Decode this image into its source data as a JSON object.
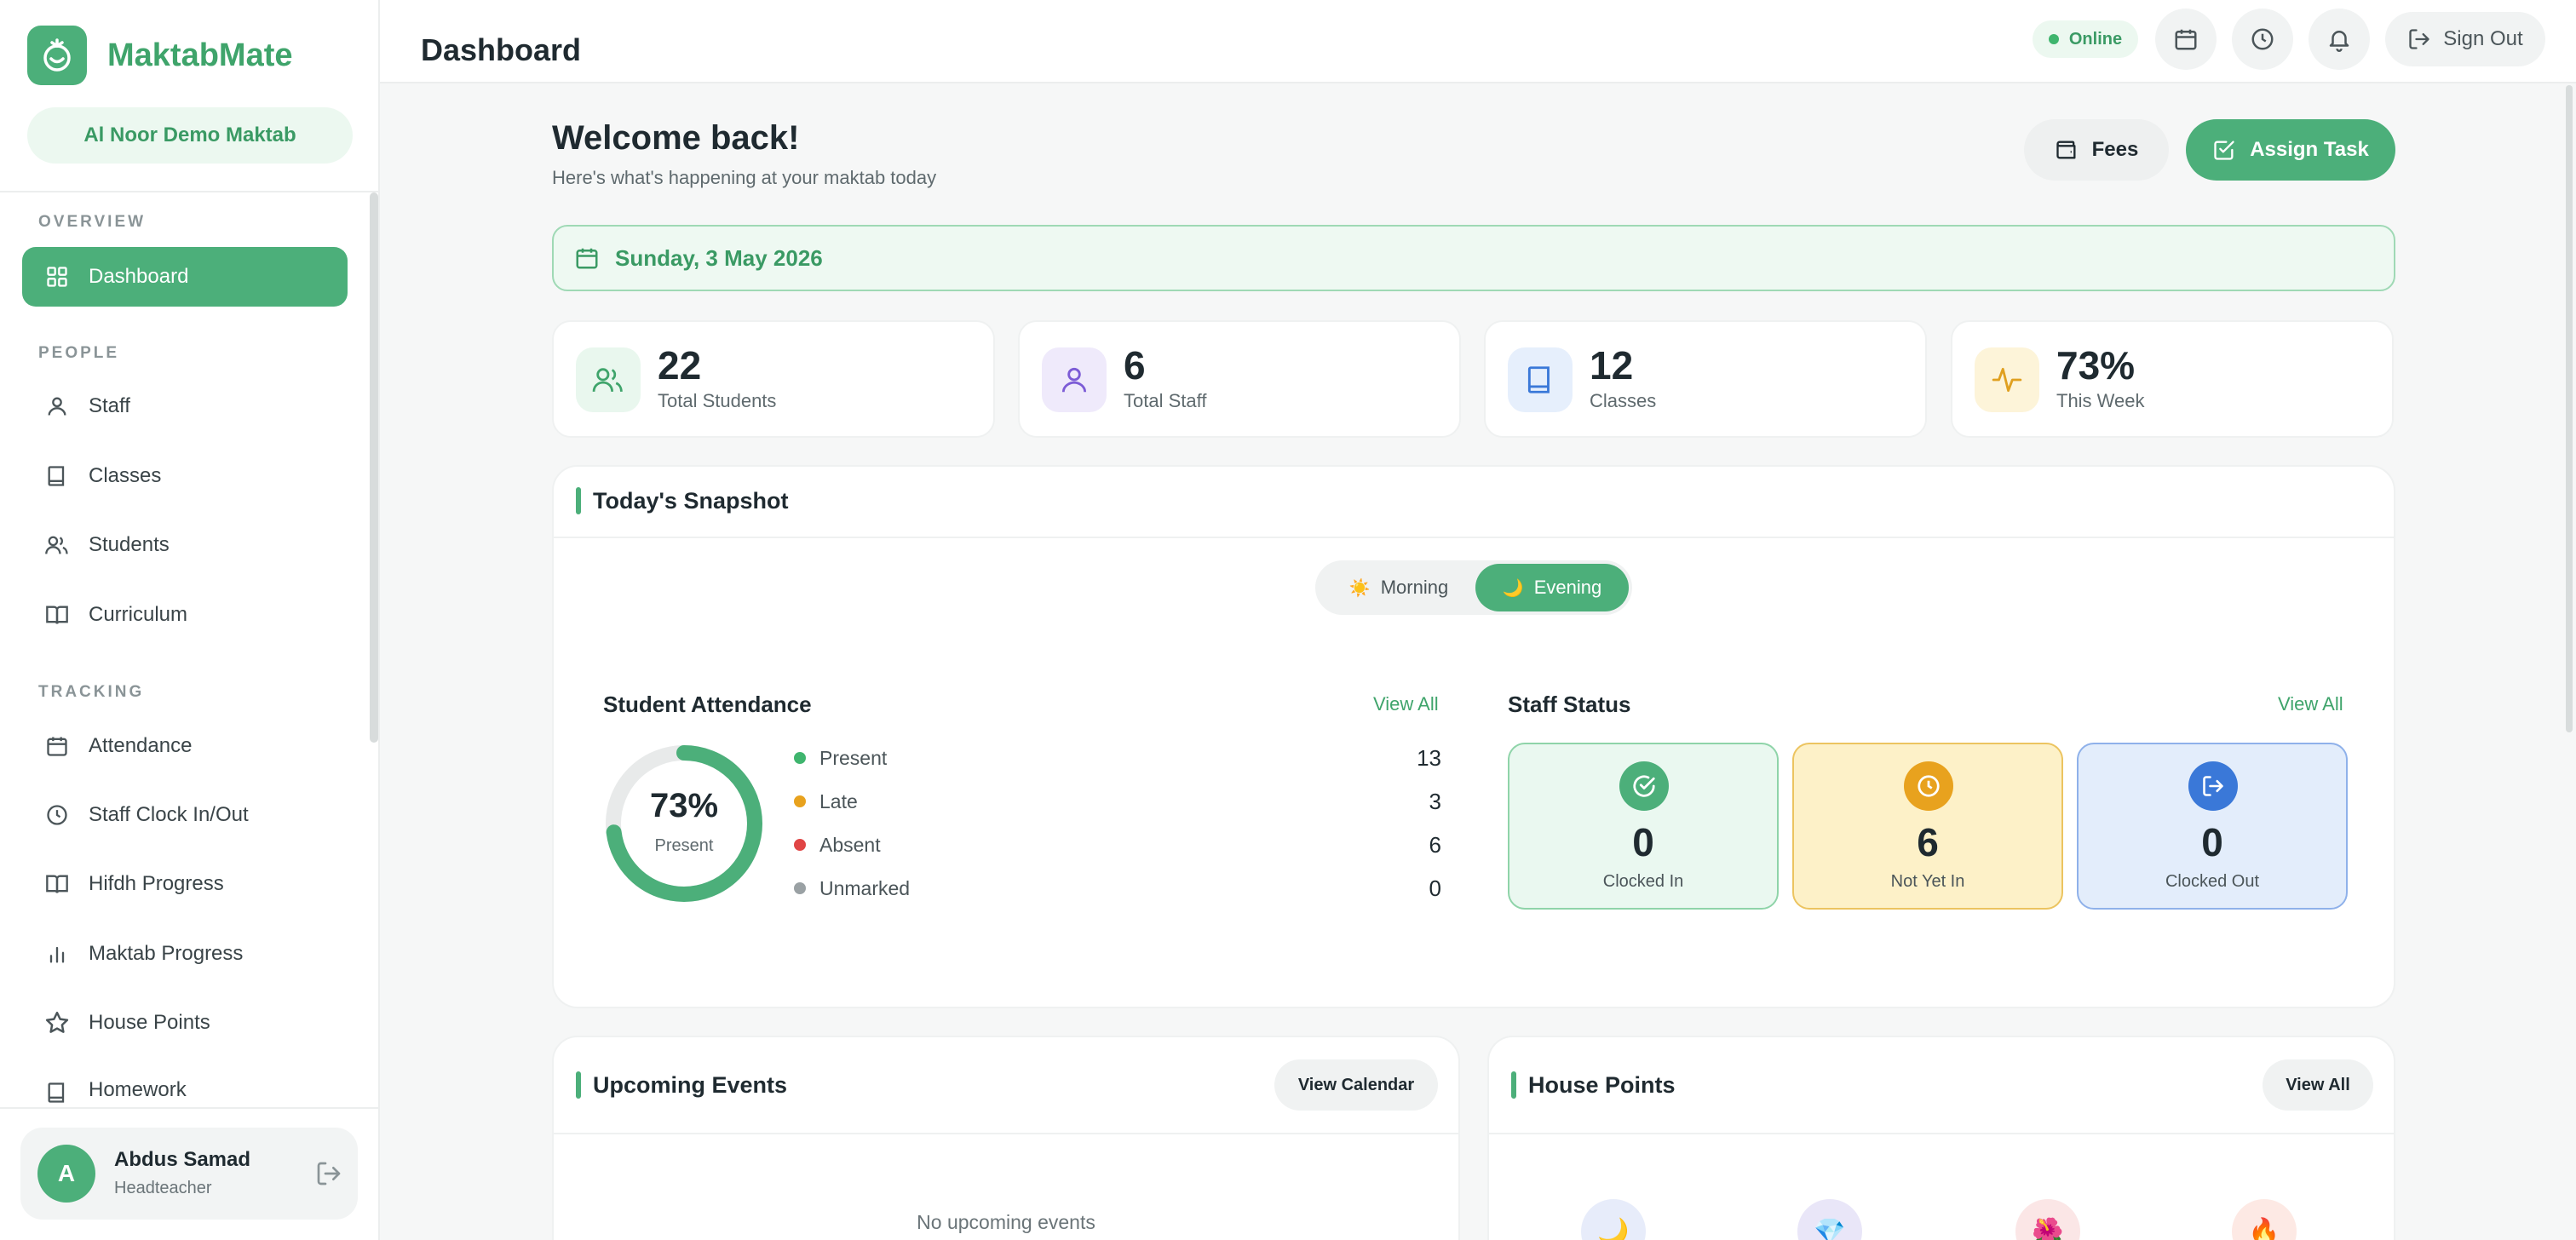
{
  "brand": {
    "name": "MaktabMate",
    "org": "Al Noor Demo Maktab"
  },
  "sidebar": {
    "sections": {
      "overview": "OVERVIEW",
      "people": "PEOPLE",
      "tracking": "TRACKING"
    },
    "items": [
      {
        "label": "Dashboard",
        "icon": "grid-icon",
        "active": true
      },
      {
        "label": "Staff",
        "icon": "person-icon"
      },
      {
        "label": "Classes",
        "icon": "book-icon"
      },
      {
        "label": "Students",
        "icon": "people-icon"
      },
      {
        "label": "Curriculum",
        "icon": "open-book-icon"
      },
      {
        "label": "Attendance",
        "icon": "calendar-icon"
      },
      {
        "label": "Staff Clock In/Out",
        "icon": "clock-icon"
      },
      {
        "label": "Hifdh Progress",
        "icon": "open-book-icon"
      },
      {
        "label": "Maktab Progress",
        "icon": "bar-chart-icon"
      },
      {
        "label": "House Points",
        "icon": "star-icon"
      },
      {
        "label": "Homework",
        "icon": "book-icon"
      }
    ],
    "user": {
      "initial": "A",
      "name": "Abdus Samad",
      "role": "Headteacher"
    }
  },
  "topbar": {
    "title": "Dashboard",
    "status": "Online",
    "signout": "Sign Out"
  },
  "welcome": {
    "title": "Welcome back!",
    "subtitle": "Here's what's happening at your maktab today"
  },
  "actions": {
    "fees": "Fees",
    "assign": "Assign Task"
  },
  "date": "Sunday, 3 May 2026",
  "stats": [
    {
      "value": "22",
      "label": "Total Students",
      "color": "#3fa46b"
    },
    {
      "value": "6",
      "label": "Total Staff",
      "color": "#7c5cd6"
    },
    {
      "value": "12",
      "label": "Classes",
      "color": "#3a78d8"
    },
    {
      "value": "73%",
      "label": "This Week",
      "color": "#e0a020"
    }
  ],
  "snapshot": {
    "title": "Today's Snapshot",
    "shifts": {
      "morning": "Morning",
      "evening": "Evening",
      "active": "evening"
    },
    "attendance": {
      "title": "Student Attendance",
      "view_all": "View All",
      "percent": "73%",
      "percent_label": "Present",
      "percent_value": 0.73,
      "rows": [
        {
          "label": "Present",
          "value": "13",
          "color": "#3fb56e"
        },
        {
          "label": "Late",
          "value": "3",
          "color": "#e8a21e"
        },
        {
          "label": "Absent",
          "value": "6",
          "color": "#e04545"
        },
        {
          "label": "Unmarked",
          "value": "0",
          "color": "#9aa1a4"
        }
      ]
    },
    "staff": {
      "title": "Staff Status",
      "view_all": "View All",
      "cards": [
        {
          "value": "0",
          "label": "Clocked In"
        },
        {
          "value": "6",
          "label": "Not Yet In"
        },
        {
          "value": "0",
          "label": "Clocked Out"
        }
      ]
    }
  },
  "events": {
    "title": "Upcoming Events",
    "button": "View Calendar",
    "empty": "No upcoming events"
  },
  "houses": {
    "title": "House Points",
    "button": "View All"
  }
}
